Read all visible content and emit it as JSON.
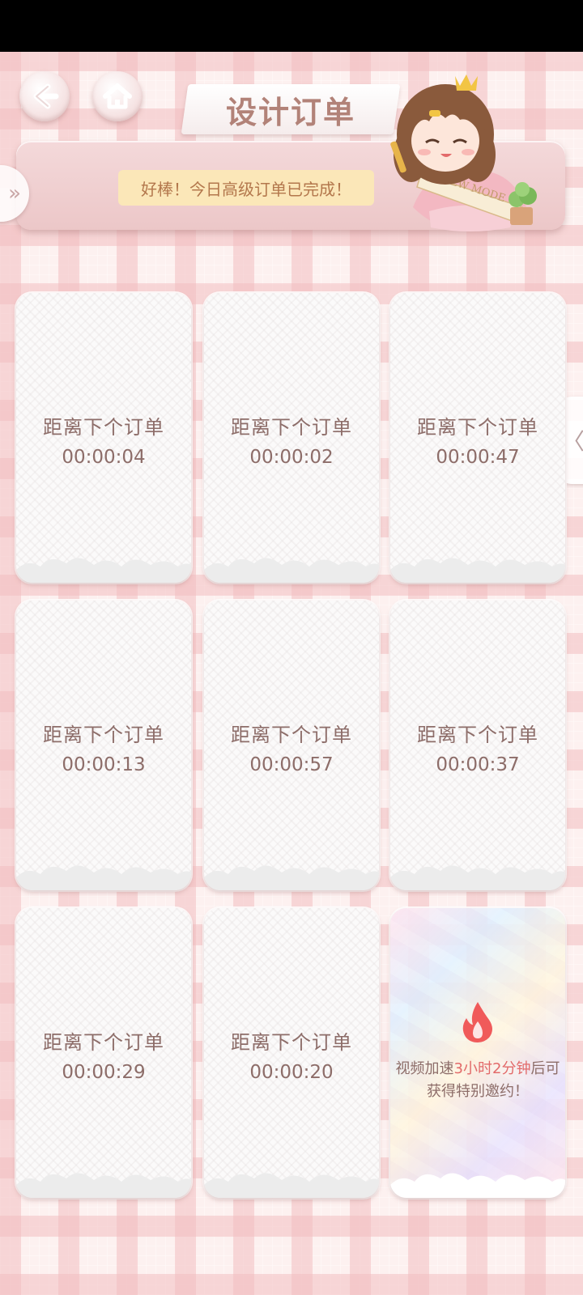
{
  "header": {
    "title": "设计订单",
    "back_icon": "back-arrow-icon",
    "home_icon": "home-icon"
  },
  "notice": {
    "message": "好棒！今日高级订单已完成！",
    "left_tab_icon": "double-chevron-right-icon"
  },
  "right_tab": {
    "icon": "chevron-left-icon",
    "glyph": "〈"
  },
  "orders": [
    {
      "label": "距离下个订单",
      "timer": "00:00:04"
    },
    {
      "label": "距离下个订单",
      "timer": "00:00:02"
    },
    {
      "label": "距离下个订单",
      "timer": "00:00:47"
    },
    {
      "label": "距离下个订单",
      "timer": "00:00:13"
    },
    {
      "label": "距离下个订单",
      "timer": "00:00:57"
    },
    {
      "label": "距离下个订单",
      "timer": "00:00:37"
    },
    {
      "label": "距离下个订单",
      "timer": "00:00:29"
    },
    {
      "label": "距离下个订单",
      "timer": "00:00:20"
    }
  ],
  "special": {
    "icon": "flame-icon",
    "line1_prefix": "视频加速",
    "line1_highlight": "3小时2分钟",
    "line1_suffix": "后可",
    "line2": "获得特别邀约！",
    "highlight_color": "#e26a6a"
  },
  "colors": {
    "text": "#8d6d69",
    "notice_bg": "#fbe7b8",
    "notice_text": "#b3774c",
    "title": "#b28278"
  }
}
